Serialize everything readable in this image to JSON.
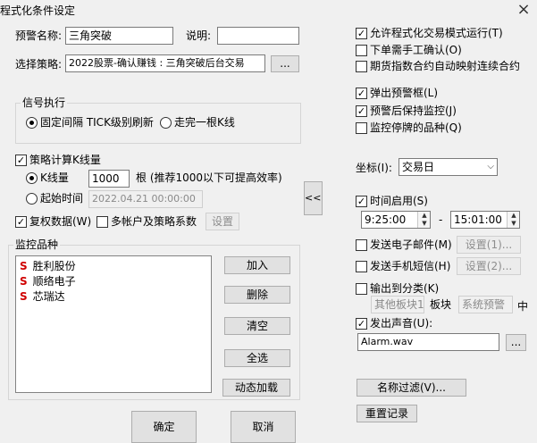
{
  "window": {
    "title": "程式化条件设定",
    "close": "×"
  },
  "alert": {
    "name_label": "预警名称:",
    "name_value": "三角突破",
    "desc_label": "说明:",
    "desc_value": "",
    "strategy_label": "选择策略:",
    "strategy_value": "2022股票-确认赚钱 : 三角突破后台交易",
    "strategy_btn": "..."
  },
  "signal": {
    "title": "信号执行",
    "fixed_interval": "固定间隔 TICK级别刷新",
    "complete_bar": "走完一根K线"
  },
  "kline": {
    "checkbox_label": "策略计算K线量",
    "count_label": "K线量",
    "count_value": "1000",
    "count_hint": "根 (推荐1000以下可提高效率)",
    "start_label": "起始时间",
    "start_value": "2022.04.21 00:00:00",
    "reweight": "复权数据(W)",
    "multi_account": "多帐户及策略系数",
    "settings_btn": "设置"
  },
  "collapse_btn": "<<<",
  "monitor": {
    "title": "监控品种",
    "items": [
      {
        "mark": "S",
        "name": "胜利股份"
      },
      {
        "mark": "S",
        "name": "顺络电子"
      },
      {
        "mark": "S",
        "name": "芯瑞达"
      }
    ],
    "add": "加入",
    "delete": "删除",
    "clear": "清空",
    "select_all": "全选",
    "dynamic_load": "动态加载"
  },
  "footer": {
    "ok": "确定",
    "cancel": "取消"
  },
  "right": {
    "allow_auto_trade": "允许程式化交易模式运行(T)",
    "manual_confirm": "下单需手工确认(O)",
    "futures_map": "期货指数合约自动映射连续合约",
    "popup_box": "弹出预警框(L)",
    "keep_monitor": "预警后保持监控(J)",
    "monitor_suspended": "监控停牌的品种(Q)",
    "coord_label": "坐标(I):",
    "coord_value": "交易日",
    "time_enable": "时间启用(S)",
    "time_from": "9:25:00",
    "time_dash": "-",
    "time_to": "15:01:00",
    "send_email": "发送电子邮件(M)",
    "email_settings": "设置(1)...",
    "send_sms": "发送手机短信(H)",
    "sms_settings": "设置(2)...",
    "output_category": "输出到分类(K)",
    "category_value": "其他板块1",
    "block_label": "板块",
    "system_alert": "系统预警",
    "mid_label": "中",
    "play_sound": "发出声音(U):",
    "sound_file": "Alarm.wav",
    "sound_btn": "...",
    "name_filter": "名称过滤(V)...",
    "reset_log": "重置记录"
  }
}
